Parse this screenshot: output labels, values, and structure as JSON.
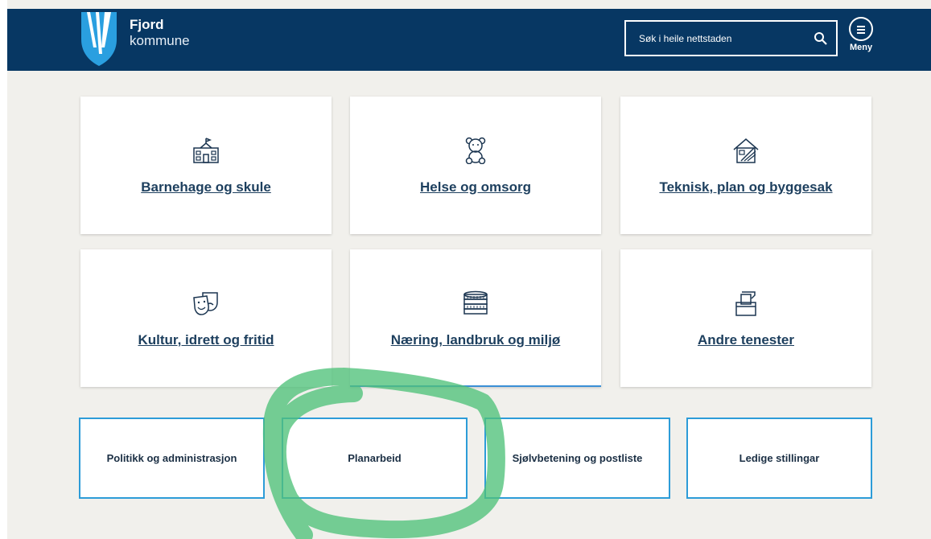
{
  "header": {
    "brand_name": "Fjord",
    "brand_sub": "kommune",
    "search_placeholder": "Søk i heile nettstaden",
    "menu_label": "Meny"
  },
  "cards": [
    {
      "title": "Barnehage og skule",
      "icon": "school-icon"
    },
    {
      "title": "Helse og omsorg",
      "icon": "teddy-bear-icon"
    },
    {
      "title": "Teknisk, plan og byggesak",
      "icon": "building-plan-icon"
    },
    {
      "title": "Kultur, idrett og fritid",
      "icon": "theater-masks-icon"
    },
    {
      "title": "Næring, landbruk og miljø",
      "icon": "coins-icon"
    },
    {
      "title": "Andre tenester",
      "icon": "ballot-box-icon"
    }
  ],
  "quick_links": [
    {
      "label": "Politikk og administrasjon"
    },
    {
      "label": "Planarbeid"
    },
    {
      "label": "Sjølvbetening og postliste"
    },
    {
      "label": "Ledige stillingar"
    }
  ],
  "colors": {
    "header_bg": "#073763",
    "page_bg": "#f1f0ec",
    "link_text": "#1d3f5e",
    "quick_border": "#2d9cd8",
    "annotation": "#4fc27a"
  }
}
